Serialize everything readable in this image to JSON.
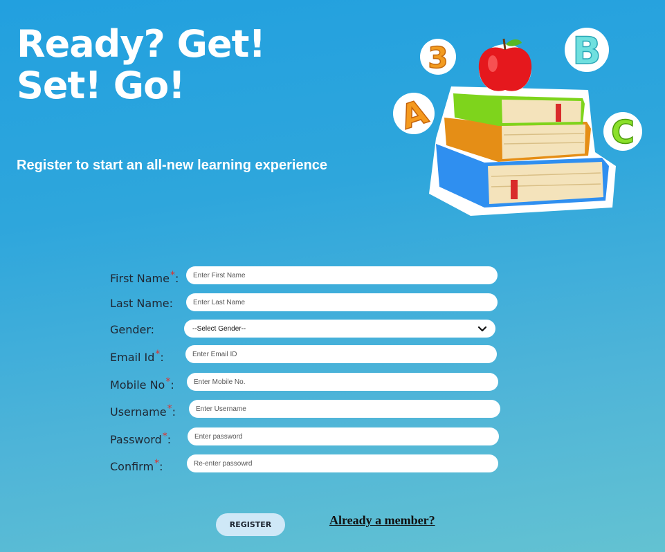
{
  "hero": {
    "title_line1": "Ready? Get!",
    "title_line2": "Set! Go!",
    "subtitle": "Register to start an all-new learning experience"
  },
  "illustration": {
    "icon": "books-apple-abc-icon",
    "letters": [
      "3",
      "B",
      "A",
      "C"
    ]
  },
  "form": {
    "required_mark": "*",
    "first_name": {
      "label": "First Name",
      "suffix": ":",
      "placeholder": "Enter First Name",
      "required": true
    },
    "last_name": {
      "label": "Last Name:",
      "placeholder": "Enter Last Name",
      "required": false
    },
    "gender": {
      "label": "Gender:",
      "selected": "--Select Gender--"
    },
    "email": {
      "label": "Email Id",
      "suffix": ":",
      "placeholder": "Enter Email ID",
      "required": true
    },
    "mobile": {
      "label": "Mobile No",
      "suffix": ":",
      "placeholder": "Enter Mobile No.",
      "required": true
    },
    "username": {
      "label": "Username",
      "suffix": ":",
      "placeholder": "Enter Username",
      "required": true
    },
    "password": {
      "label": "Password",
      "suffix": ":",
      "placeholder": "Enter password",
      "required": true
    },
    "confirm": {
      "label": "Confirm",
      "suffix": ":",
      "placeholder": "Re-enter passowrd",
      "required": true
    }
  },
  "actions": {
    "register_label": "REGISTER",
    "member_link": "Already a member?"
  },
  "colors": {
    "background_top": "#22a0df",
    "background_bottom": "#63c2d2",
    "required": "#e0302a",
    "button_bg": "#cfe8f7"
  }
}
